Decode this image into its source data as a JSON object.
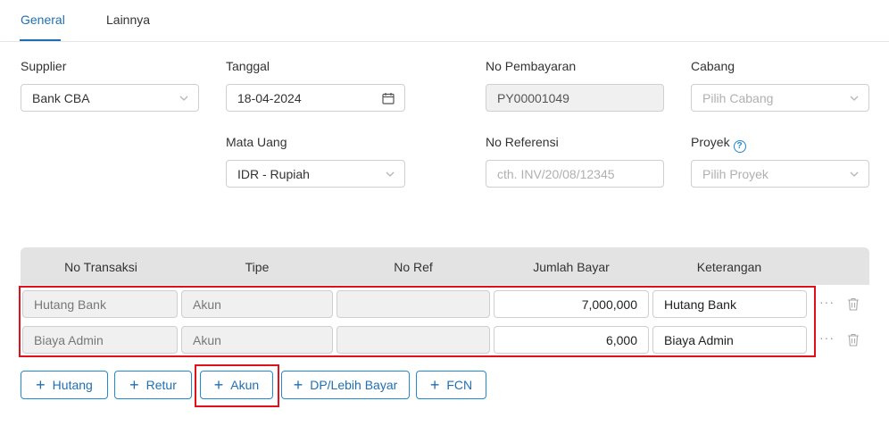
{
  "tabs": [
    {
      "label": "General",
      "active": true
    },
    {
      "label": "Lainnya",
      "active": false
    }
  ],
  "form": {
    "supplier": {
      "label": "Supplier",
      "value": "Bank CBA"
    },
    "tanggal": {
      "label": "Tanggal",
      "value": "18-04-2024"
    },
    "no_pembayaran": {
      "label": "No Pembayaran",
      "value": "PY00001049"
    },
    "cabang": {
      "label": "Cabang",
      "placeholder": "Pilih Cabang"
    },
    "mata_uang": {
      "label": "Mata Uang",
      "value": "IDR - Rupiah"
    },
    "no_referensi": {
      "label": "No Referensi",
      "placeholder": "cth. INV/20/08/12345"
    },
    "proyek": {
      "label": "Proyek",
      "placeholder": "Pilih Proyek"
    }
  },
  "table": {
    "headers": [
      "No Transaksi",
      "Tipe",
      "No Ref",
      "Jumlah Bayar",
      "Keterangan"
    ],
    "rows": [
      {
        "no_transaksi": "Hutang Bank",
        "tipe": "Akun",
        "no_ref": "",
        "jumlah_bayar": "7,000,000",
        "keterangan": "Hutang Bank"
      },
      {
        "no_transaksi": "Biaya Admin",
        "tipe": "Akun",
        "no_ref": "",
        "jumlah_bayar": "6,000",
        "keterangan": "Biaya Admin"
      }
    ],
    "row_menu_glyph": "···"
  },
  "buttons": {
    "plus_glyph": "+",
    "hutang": "Hutang",
    "retur": "Retur",
    "akun": "Akun",
    "dp_lebih_bayar": "DP/Lebih Bayar",
    "fcn": "FCN"
  },
  "colors": {
    "accent": "#1f6fb2",
    "highlight": "#e0111b",
    "table_header_bg": "#e3e3e3",
    "readonly_bg": "#f0f0f0"
  },
  "icons": {
    "dropdown": "chevron-down-icon",
    "date": "calendar-icon",
    "help": "question-circle-icon",
    "row_menu": "more-horizontal-icon",
    "delete": "trash-icon",
    "add": "plus-icon"
  }
}
